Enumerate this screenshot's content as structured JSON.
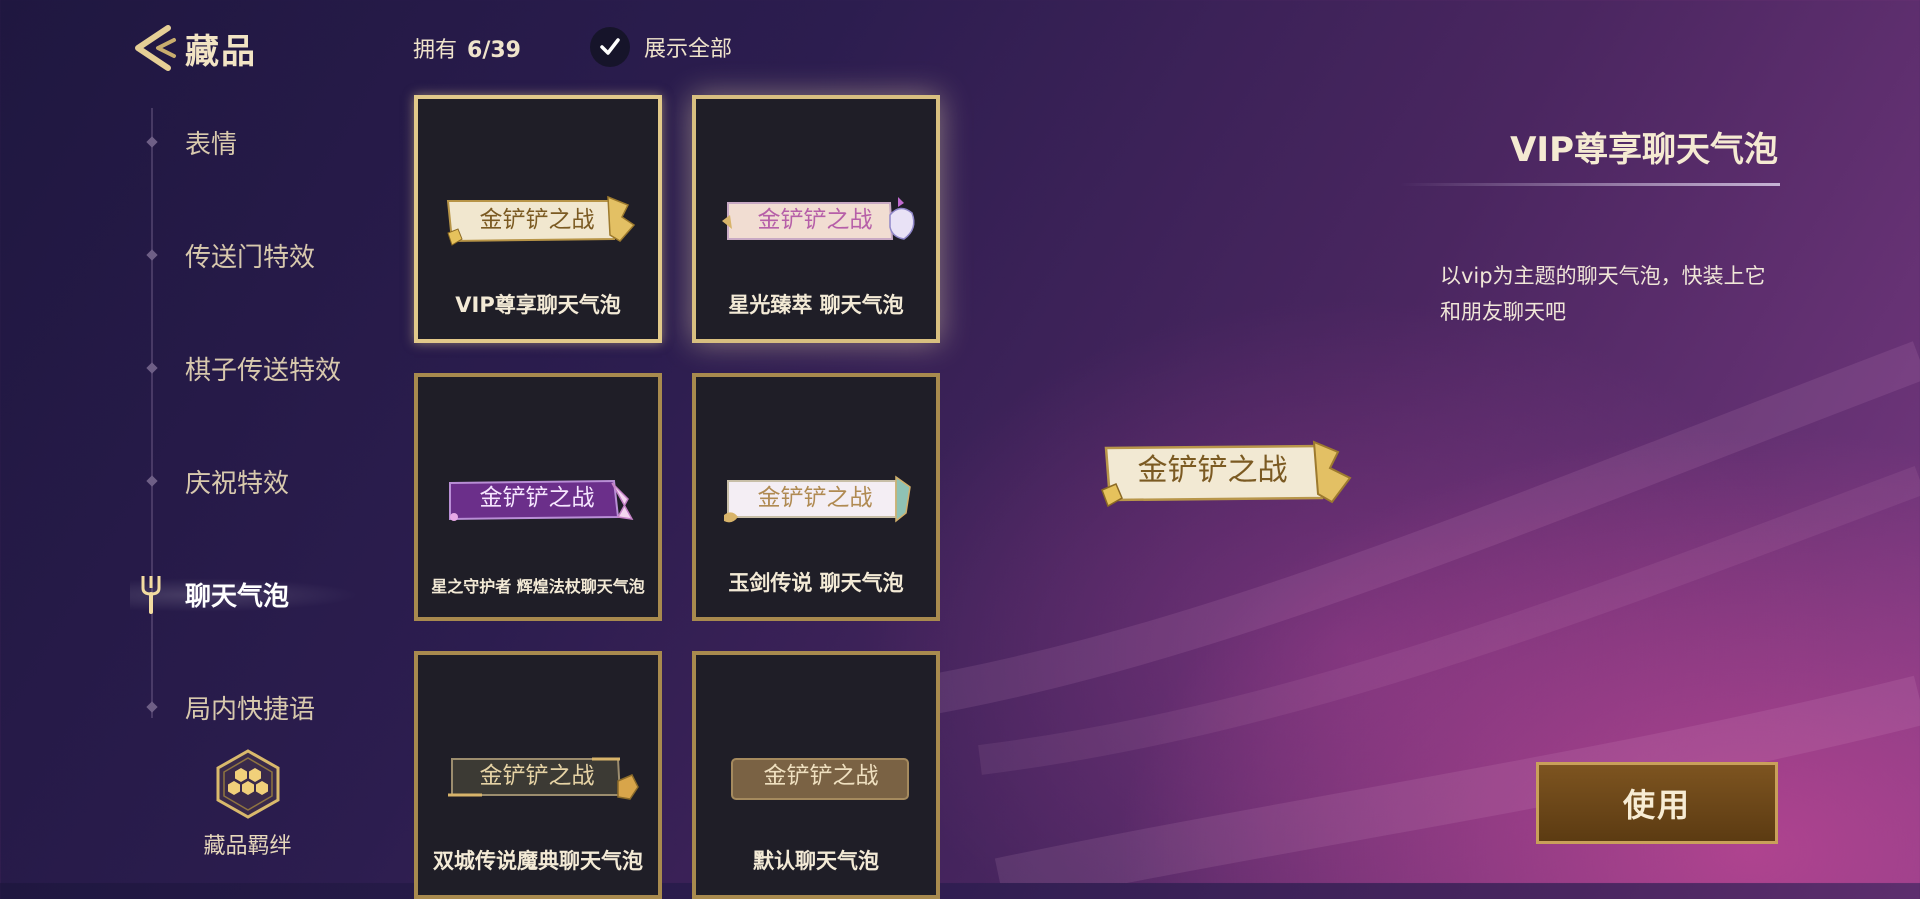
{
  "header": {
    "title": "藏品",
    "owned_label": "拥有",
    "owned_count": "6/39",
    "show_all_label": "展示全部",
    "show_all_checked": true
  },
  "sidebar": {
    "items": [
      {
        "label": "表情",
        "active": false
      },
      {
        "label": "传送门特效",
        "active": false
      },
      {
        "label": "棋子传送特效",
        "active": false
      },
      {
        "label": "庆祝特效",
        "active": false
      },
      {
        "label": "聊天气泡",
        "active": true
      },
      {
        "label": "局内快捷语",
        "active": false
      }
    ],
    "bond_label": "藏品羁绊",
    "bond_icon": "honeycomb-hexagon-icon"
  },
  "grid": {
    "items": [
      {
        "bubble_text": "金铲铲之战",
        "label": "VIP尊享聊天气泡",
        "style": "vip",
        "selected": true
      },
      {
        "bubble_text": "金铲铲之战",
        "label": "星光臻萃  聊天气泡",
        "style": "star",
        "selected": false
      },
      {
        "bubble_text": "金铲铲之战",
        "label": "星之守护者  辉煌法杖聊天气泡",
        "style": "guardian",
        "selected": false
      },
      {
        "bubble_text": "金铲铲之战",
        "label": "玉剑传说  聊天气泡",
        "style": "jade",
        "selected": false
      },
      {
        "bubble_text": "金铲铲之战",
        "label": "双城传说魔典聊天气泡",
        "style": "arcane",
        "selected": false
      },
      {
        "bubble_text": "金铲铲之战",
        "label": "默认聊天气泡",
        "style": "default",
        "selected": false
      }
    ]
  },
  "detail": {
    "title": "VIP尊享聊天气泡",
    "description": "以vip为主题的聊天气泡，快装上它和朋友聊天吧",
    "preview_bubble_text": "金铲铲之战",
    "use_button_label": "使用"
  },
  "colors": {
    "gold_border": "#a88a4e",
    "card_bg": "#1f1e27",
    "accent_text": "#f2e4c4",
    "use_button": "#6b4718"
  }
}
